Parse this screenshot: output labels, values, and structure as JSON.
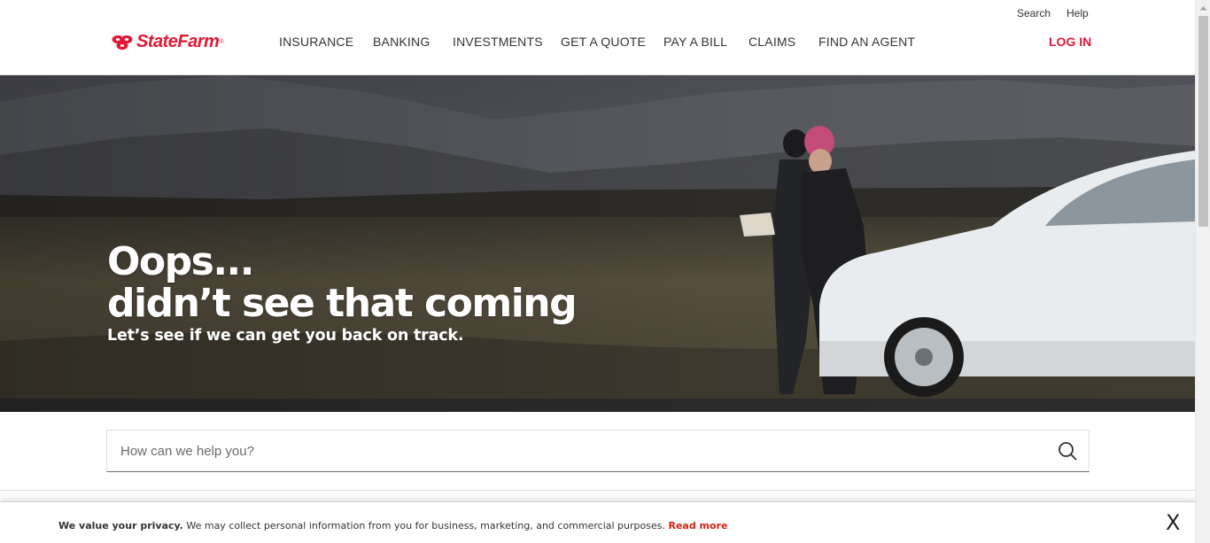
{
  "header": {
    "brand": "StateFarm",
    "brand_tm": "®",
    "utility": {
      "search": "Search",
      "help": "Help"
    },
    "nav": [
      "INSURANCE",
      "BANKING",
      "INVESTMENTS",
      "GET A QUOTE",
      "PAY A BILL",
      "CLAIMS",
      "FIND AN AGENT"
    ],
    "login": "LOG IN"
  },
  "hero": {
    "line1": "Oops...",
    "line2": "didn’t see that coming",
    "subtitle": "Let’s see if we can get you back on track."
  },
  "search": {
    "placeholder": "How can we help you?",
    "icon": "search-icon"
  },
  "privacy": {
    "bold": "We value your privacy.",
    "text": " We may collect personal information from you for business, marketing, and commercial purposes. ",
    "link": "Read more",
    "close": "X"
  },
  "colors": {
    "brand_red": "#e31837",
    "link_red": "#d62311"
  }
}
